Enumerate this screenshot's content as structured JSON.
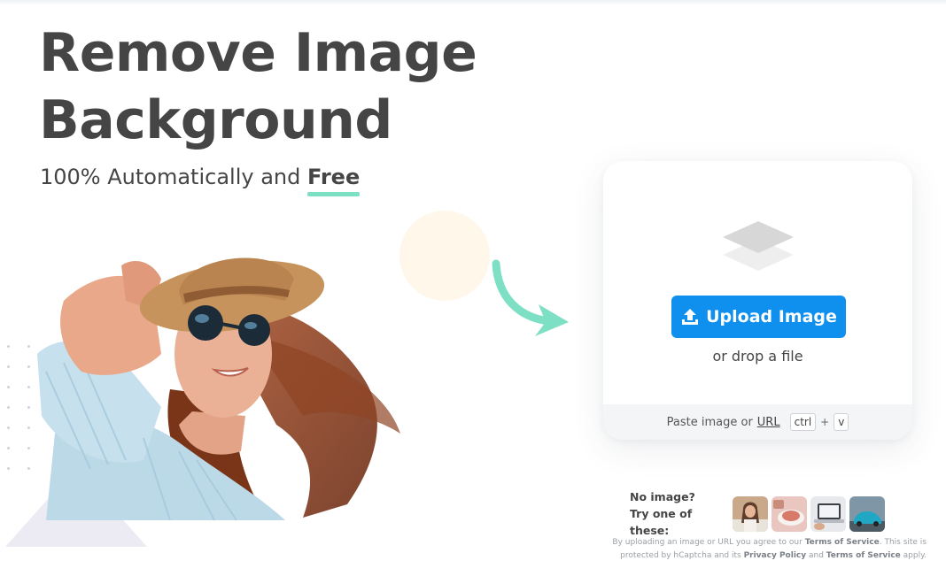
{
  "hero": {
    "title_line1": "Remove Image",
    "title_line2": "Background",
    "subtitle_prefix": "100% Automatically and ",
    "subtitle_highlight": "Free"
  },
  "upload": {
    "button_label": "Upload Image",
    "drop_text": "or drop a file",
    "paste_text": "Paste image or",
    "url_link": "URL",
    "key_ctrl": "ctrl",
    "key_plus": "+",
    "key_v": "v"
  },
  "samples": {
    "line1": "No image?",
    "line2": "Try one of these:",
    "thumbnails": [
      "sample-woman",
      "sample-food",
      "sample-laptop",
      "sample-car"
    ]
  },
  "legal": {
    "part1": "By uploading an image or URL you agree to our ",
    "terms1": "Terms of Service",
    "part2": ". This site is protected by hCaptcha and its ",
    "privacy": "Privacy Policy",
    "part3": " and ",
    "terms2": "Terms of Service",
    "part4": " apply."
  },
  "colors": {
    "primary_button": "#0f8fee",
    "highlight_underline": "#7de0c4",
    "arrow": "#7de0c4",
    "heading_text": "#454545"
  },
  "icons": [
    "layers-icon",
    "upload-icon",
    "curved-arrow-icon"
  ]
}
